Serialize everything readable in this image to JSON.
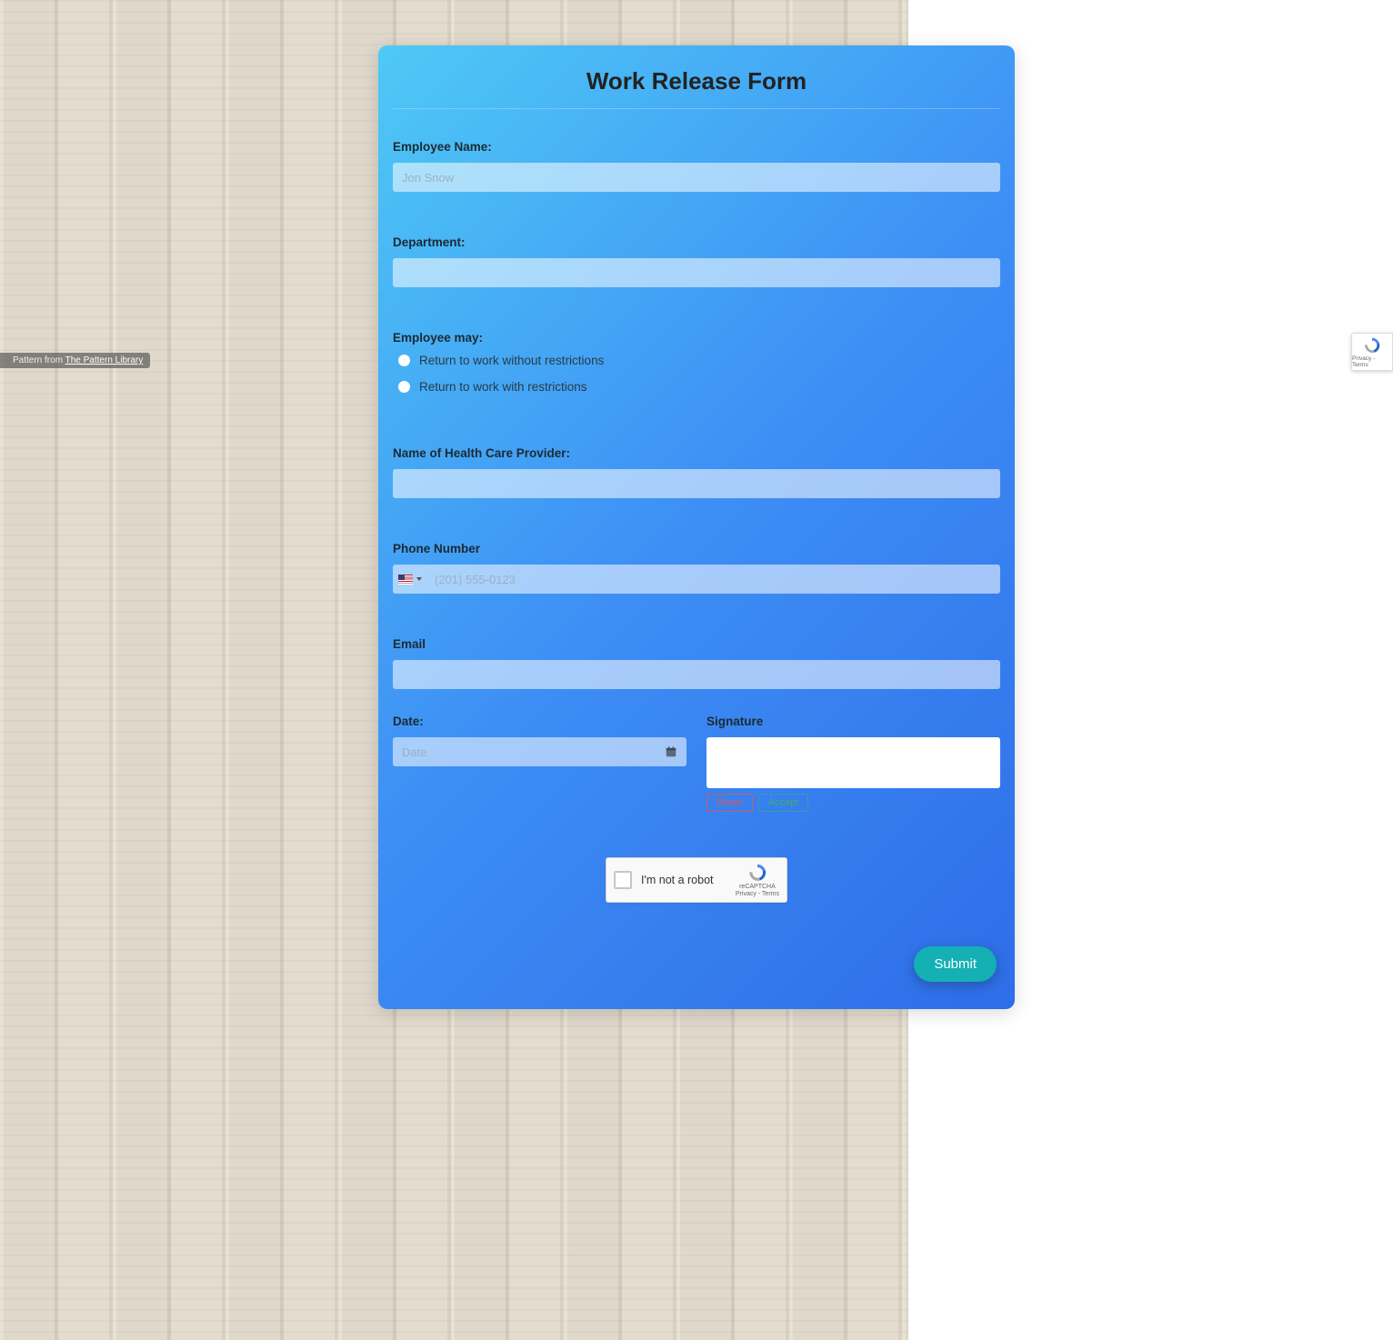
{
  "form": {
    "title": "Work Release Form",
    "employee_name": {
      "label": "Employee Name:",
      "placeholder": "Jon Snow",
      "value": ""
    },
    "department": {
      "label": "Department:",
      "value": ""
    },
    "employee_may": {
      "label": "Employee may:",
      "options": [
        "Return to work without restrictions",
        "Return to work with restrictions"
      ]
    },
    "provider": {
      "label": "Name of Health Care Provider:",
      "value": ""
    },
    "phone": {
      "label": "Phone Number",
      "placeholder": "(201) 555-0123",
      "value": "",
      "country": "US"
    },
    "email": {
      "label": "Email",
      "value": ""
    },
    "date": {
      "label": "Date:",
      "placeholder": "Date",
      "value": ""
    },
    "signature": {
      "label": "Signature",
      "reset": "Reset",
      "accept": "Accept"
    },
    "captcha": {
      "label": "I'm not a robot",
      "brand": "reCAPTCHA",
      "legal": "Privacy - Terms"
    },
    "submit": "Submit"
  },
  "credit": {
    "prefix": "Pattern from ",
    "link_text": "The Pattern Library"
  },
  "badge": {
    "brand": "reCAPTCHA",
    "legal": "Privacy - Terms"
  }
}
